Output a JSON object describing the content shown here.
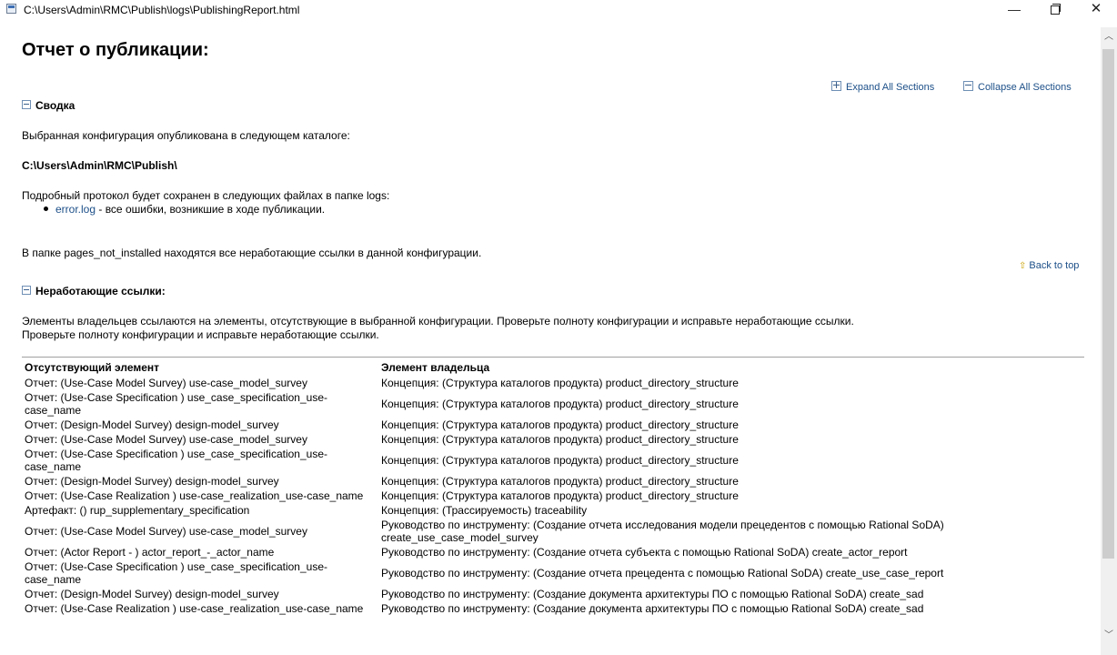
{
  "window": {
    "title": "C:\\Users\\Admin\\RMC\\Publish\\logs\\PublishingReport.html",
    "minimize_glyph": "—",
    "close_glyph": "✕"
  },
  "page": {
    "heading": "Отчет о публикации:",
    "expand_all": "Expand All Sections",
    "collapse_all": "Collapse All Sections"
  },
  "summary": {
    "title": "Сводка",
    "line1": "Выбранная конфигурация опубликована в следующем каталоге:",
    "path": "C:\\Users\\Admin\\RMC\\Publish\\",
    "line2": "Подробный протокол будет сохранен в следующих файлах в папке logs:",
    "bullet_link": "error.log",
    "bullet_text": " - все ошибки, возникшие в ходе публикации.",
    "line3": "В папке pages_not_installed находятся все неработающие ссылки в данной конфигурации.",
    "back_to_top": "Back to top"
  },
  "broken_links": {
    "title": "Неработающие ссылки:",
    "desc1": "Элементы владельцев ссылаются на элементы, отсутствующие в выбранной конфигурации. Проверьте полноту конфигурации и исправьте неработающие ссылки.",
    "desc2": "Проверьте полноту конфигурации и исправьте неработающие ссылки.",
    "col_missing": "Отсутствующий элемент",
    "col_owner": "Элемент владельца",
    "rows": [
      {
        "missing": "Отчет: (Use-Case Model Survey) use-case_model_survey",
        "owner": "Концепция: (Структура каталогов продукта) product_directory_structure"
      },
      {
        "missing": "Отчет: (Use-Case Specification ) use_case_specification_use-\ncase_name",
        "owner": "Концепция: (Структура каталогов продукта) product_directory_structure"
      },
      {
        "missing": "Отчет: (Design-Model Survey) design-model_survey",
        "owner": "Концепция: (Структура каталогов продукта) product_directory_structure"
      },
      {
        "missing": "Отчет: (Use-Case Model Survey) use-case_model_survey",
        "owner": "Концепция: (Структура каталогов продукта) product_directory_structure"
      },
      {
        "missing": "Отчет: (Use-Case Specification ) use_case_specification_use-\ncase_name",
        "owner": "Концепция: (Структура каталогов продукта) product_directory_structure"
      },
      {
        "missing": "Отчет: (Design-Model Survey) design-model_survey",
        "owner": "Концепция: (Структура каталогов продукта) product_directory_structure"
      },
      {
        "missing": "Отчет: (Use-Case Realization ) use-case_realization_use-case_name",
        "owner": "Концепция: (Структура каталогов продукта) product_directory_structure"
      },
      {
        "missing": "Артефакт: () rup_supplementary_specification",
        "owner": "Концепция: (Трассируемость) traceability"
      },
      {
        "missing": "Отчет: (Use-Case Model Survey) use-case_model_survey",
        "owner": "Руководство по инструменту: (Создание отчета исследования модели прецедентов с помощью Rational SoDA)\ncreate_use_case_model_survey"
      },
      {
        "missing": "Отчет: (Actor Report - ) actor_report_-_actor_name",
        "owner": "Руководство по инструменту: (Создание отчета субъекта с помощью Rational SoDA) create_actor_report"
      },
      {
        "missing": "Отчет: (Use-Case Specification ) use_case_specification_use-\ncase_name",
        "owner": "Руководство по инструменту: (Создание отчета прецедента с помощью Rational SoDA) create_use_case_report"
      },
      {
        "missing": "Отчет: (Design-Model Survey) design-model_survey",
        "owner": "Руководство по инструменту: (Создание документа архитектуры ПО с помощью Rational SoDA) create_sad"
      },
      {
        "missing": "Отчет: (Use-Case Realization ) use-case_realization_use-case_name",
        "owner": "Руководство по инструменту: (Создание документа архитектуры ПО с помощью Rational SoDA) create_sad"
      }
    ]
  }
}
